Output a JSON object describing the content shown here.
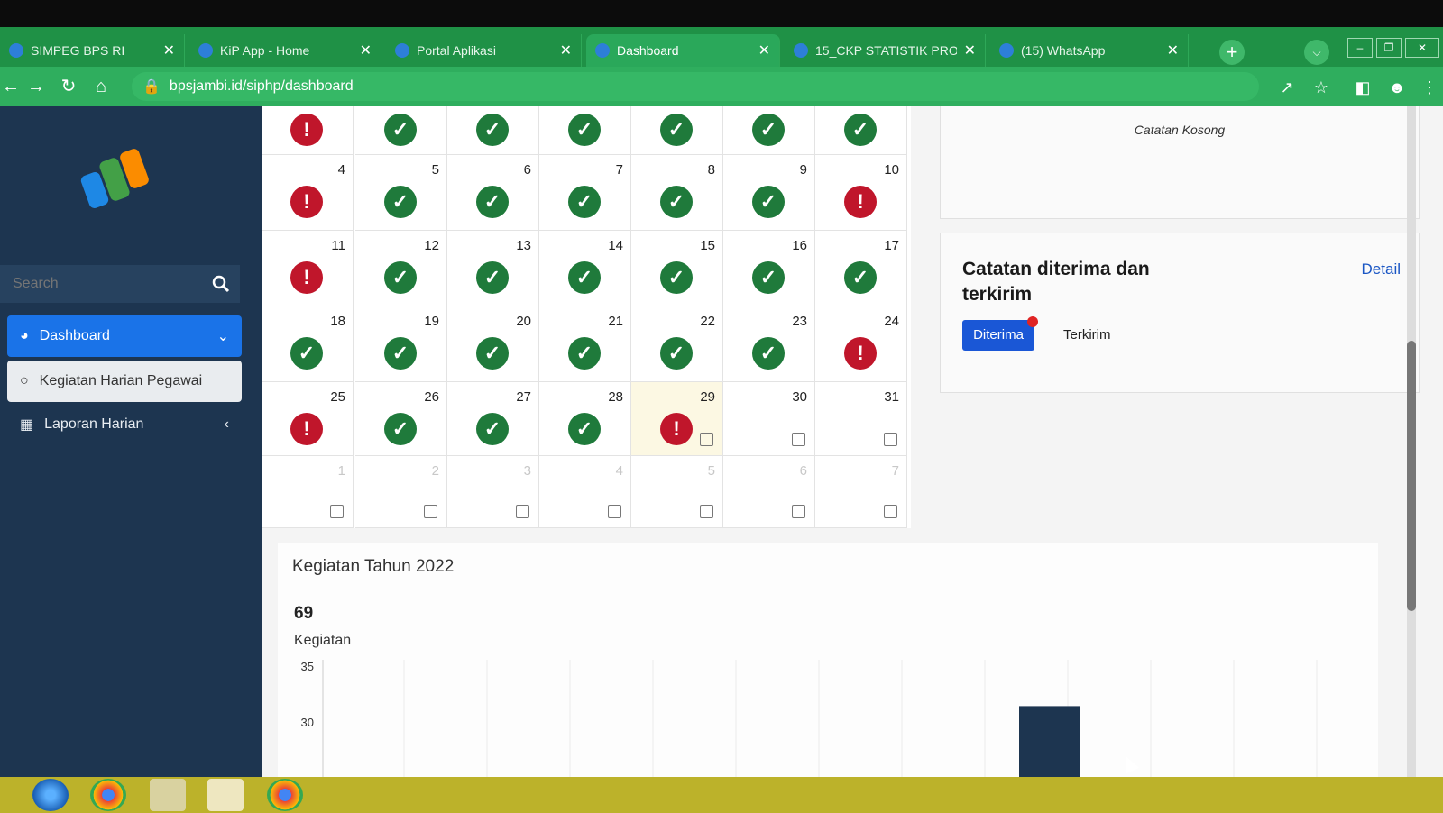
{
  "browser": {
    "tabs": [
      {
        "label": "SIMPEG BPS RI",
        "active": false
      },
      {
        "label": "KiP App - Home",
        "active": false
      },
      {
        "label": "Portal Aplikasi",
        "active": false
      },
      {
        "label": "Dashboard",
        "active": true
      },
      {
        "label": "15_CKP STATISTIK PRO",
        "active": false
      },
      {
        "label": "(15) WhatsApp",
        "active": false
      }
    ],
    "url": "bpsjambi.id/siphp/dashboard",
    "colors": {
      "tab_bar": "#1f9146",
      "active_tab": "#2aa85a",
      "toolbar": "#2fae5e"
    }
  },
  "sidebar": {
    "search_placeholder": "Search",
    "items": [
      {
        "label": "Dashboard",
        "icon": "gauge-icon",
        "active": true,
        "expanded": true
      },
      {
        "label": "Kegiatan Harian Pegawai",
        "icon": "circle-icon",
        "sub": true
      },
      {
        "label": "Laporan Harian",
        "icon": "book-icon",
        "collapsed": true
      }
    ],
    "colors": {
      "background": "#1d3550",
      "active": "#1a73e8"
    }
  },
  "calendar": {
    "rows": [
      [
        {
          "day": "",
          "status": "warn"
        },
        {
          "day": "",
          "status": "ok"
        },
        {
          "day": "",
          "status": "ok"
        },
        {
          "day": "",
          "status": "ok"
        },
        {
          "day": "",
          "status": "ok"
        },
        {
          "day": "",
          "status": "ok"
        },
        {
          "day": "",
          "status": "ok"
        }
      ],
      [
        {
          "day": "4",
          "status": "warn"
        },
        {
          "day": "5",
          "status": "ok"
        },
        {
          "day": "6",
          "status": "ok"
        },
        {
          "day": "7",
          "status": "ok"
        },
        {
          "day": "8",
          "status": "ok"
        },
        {
          "day": "9",
          "status": "ok"
        },
        {
          "day": "10",
          "status": "warn"
        }
      ],
      [
        {
          "day": "11",
          "status": "warn"
        },
        {
          "day": "12",
          "status": "ok"
        },
        {
          "day": "13",
          "status": "ok"
        },
        {
          "day": "14",
          "status": "ok"
        },
        {
          "day": "15",
          "status": "ok"
        },
        {
          "day": "16",
          "status": "ok"
        },
        {
          "day": "17",
          "status": "ok"
        }
      ],
      [
        {
          "day": "18",
          "status": "ok"
        },
        {
          "day": "19",
          "status": "ok"
        },
        {
          "day": "20",
          "status": "ok"
        },
        {
          "day": "21",
          "status": "ok"
        },
        {
          "day": "22",
          "status": "ok"
        },
        {
          "day": "23",
          "status": "ok"
        },
        {
          "day": "24",
          "status": "warn"
        }
      ],
      [
        {
          "day": "25",
          "status": "warn"
        },
        {
          "day": "26",
          "status": "ok"
        },
        {
          "day": "27",
          "status": "ok"
        },
        {
          "day": "28",
          "status": "ok"
        },
        {
          "day": "29",
          "status": "warn",
          "today": true,
          "note": true
        },
        {
          "day": "30",
          "note": true
        },
        {
          "day": "31",
          "note": true
        }
      ],
      [
        {
          "day": "1",
          "other": true,
          "note": true
        },
        {
          "day": "2",
          "other": true,
          "note": true
        },
        {
          "day": "3",
          "other": true,
          "note": true
        },
        {
          "day": "4",
          "other": true,
          "note": true
        },
        {
          "day": "5",
          "other": true,
          "note": true
        },
        {
          "day": "6",
          "other": true,
          "note": true
        },
        {
          "day": "7",
          "other": true,
          "note": true
        }
      ]
    ],
    "status_colors": {
      "ok": "#1f7a3b",
      "warn": "#c0162b"
    }
  },
  "notes_card": {
    "empty_text": "Catatan Kosong"
  },
  "received_card": {
    "title": "Catatan diterima dan terkirim",
    "detail_link": "Detail",
    "tab_received": "Diterima",
    "tab_sent": "Terkirim"
  },
  "activity_card": {
    "title": "Kegiatan Tahun 2022",
    "count": "69",
    "count_label": "Kegiatan"
  },
  "chart_data": {
    "type": "bar",
    "y_ticks": [
      "35",
      "30"
    ],
    "bars": [
      {
        "value": 31.5
      }
    ],
    "bar_color": "#1d3550"
  }
}
